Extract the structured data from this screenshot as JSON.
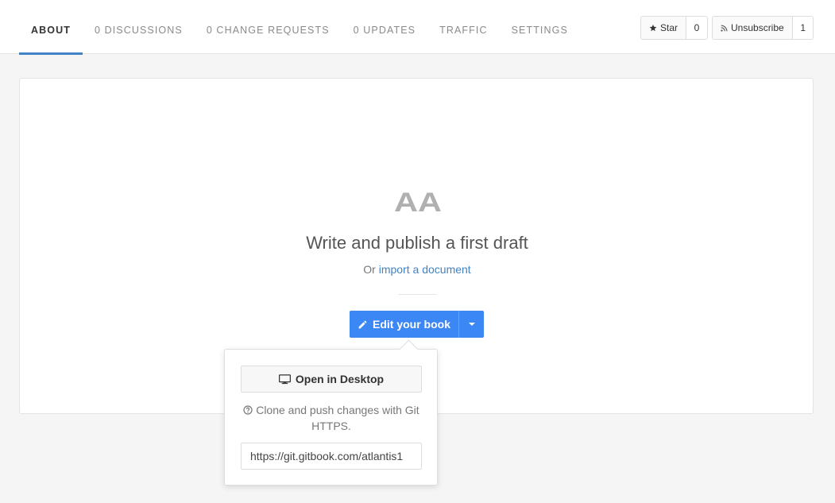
{
  "nav": {
    "tabs": [
      {
        "label": "ABOUT"
      },
      {
        "label": "0 DISCUSSIONS"
      },
      {
        "label": "0 CHANGE REQUESTS"
      },
      {
        "label": "0 UPDATES"
      },
      {
        "label": "TRAFFIC"
      },
      {
        "label": "SETTINGS"
      }
    ]
  },
  "actions": {
    "star": {
      "label": "Star",
      "count": "0",
      "icon": "star-icon"
    },
    "unsubscribe": {
      "label": "Unsubscribe",
      "count": "1",
      "icon": "rss-icon"
    }
  },
  "empty_state": {
    "logo_text": "AA",
    "heading": "Write and publish a first draft",
    "sub_prefix": "Or",
    "sub_link": "import a document"
  },
  "edit": {
    "label": "Edit your book",
    "icon": "pencil-icon",
    "caret_icon": "caret-down-icon"
  },
  "popover": {
    "open_desktop_label": "Open in Desktop",
    "open_desktop_icon": "monitor-icon",
    "help_icon": "question-circle-icon",
    "help_text": "Clone and push changes with Git HTTPS.",
    "git_url": "https://git.gitbook.com/atlantis1"
  },
  "colors": {
    "accent": "#3b87f5",
    "link": "#4183c4",
    "logo_gray": "#b0b0b0"
  }
}
